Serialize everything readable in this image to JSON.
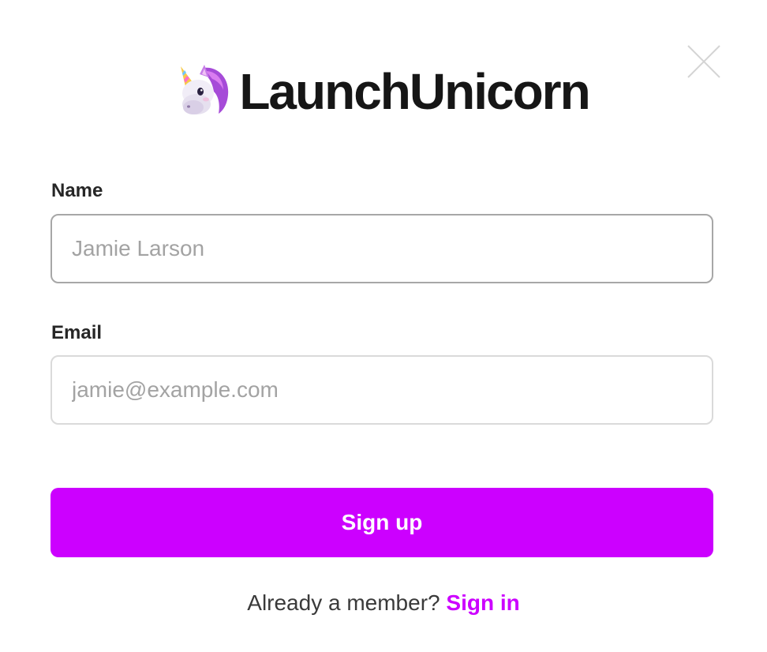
{
  "brand": {
    "name": "LaunchUnicorn",
    "logo_icon": "unicorn-icon"
  },
  "close": {
    "icon": "close-icon"
  },
  "form": {
    "name_label": "Name",
    "name_placeholder": "Jamie Larson",
    "name_value": "",
    "email_label": "Email",
    "email_placeholder": "jamie@example.com",
    "email_value": "",
    "submit_label": "Sign up"
  },
  "footer": {
    "prompt": "Already a member?",
    "link_label": "Sign in"
  },
  "colors": {
    "accent": "#cc00ff",
    "text": "#262626",
    "placeholder": "#a3a3a3"
  }
}
